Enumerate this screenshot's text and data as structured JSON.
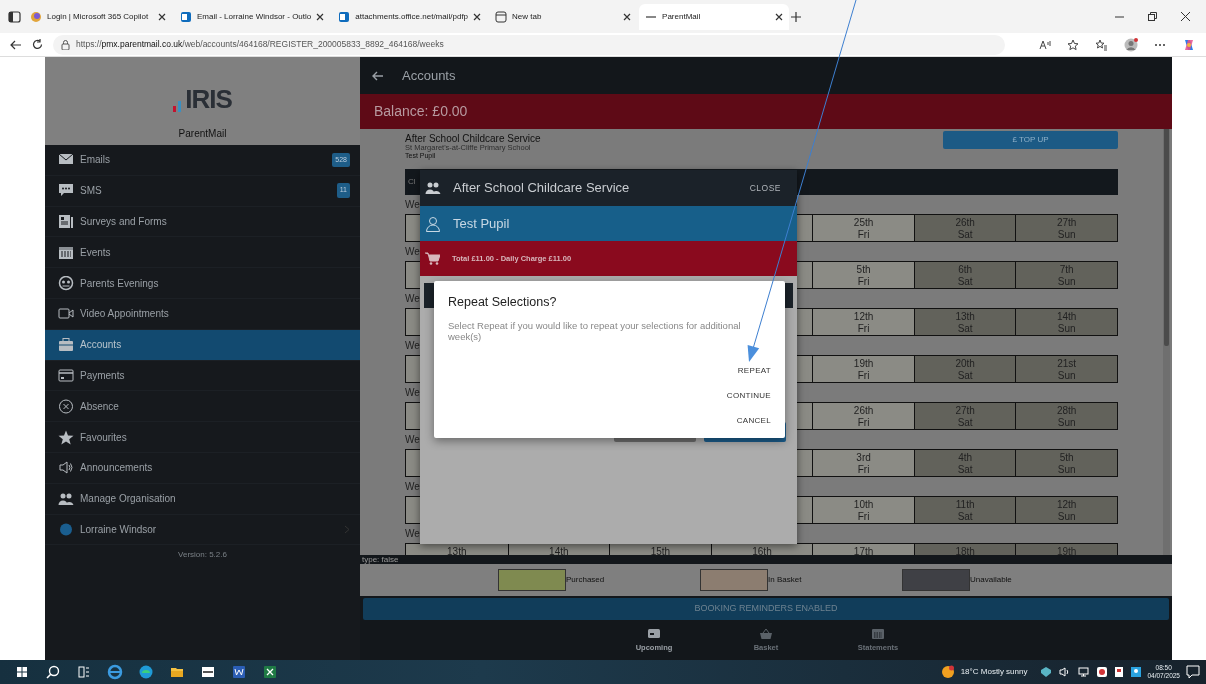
{
  "browser": {
    "tabs": [
      {
        "title": "Login | Microsoft 365 Copilot",
        "selected": false
      },
      {
        "title": "Email - Lorraine Windsor - Outlo",
        "selected": false
      },
      {
        "title": "attachments.office.net/mail/pdfp",
        "selected": false
      },
      {
        "title": "New tab",
        "selected": false
      },
      {
        "title": "ParentMail",
        "selected": true
      }
    ],
    "address": "https://**pmx.parentmail.co.uk**/web/accounts/464168/REGISTER_200005833_8892_464168/weeks"
  },
  "sidebar": {
    "logo": "IRIS",
    "app_name": "ParentMail",
    "items": [
      {
        "label": "Emails",
        "badge": "528",
        "selected": false
      },
      {
        "label": "SMS",
        "badge": "11",
        "selected": false
      },
      {
        "label": "Surveys and Forms",
        "selected": false
      },
      {
        "label": "Events",
        "selected": false
      },
      {
        "label": "Parents Evenings",
        "selected": false
      },
      {
        "label": "Video Appointments",
        "selected": false
      },
      {
        "label": "Accounts",
        "selected": true
      },
      {
        "label": "Payments",
        "selected": false
      },
      {
        "label": "Absence",
        "selected": false
      },
      {
        "label": "Favourites",
        "selected": false
      },
      {
        "label": "Announcements",
        "selected": false
      },
      {
        "label": "Manage Organisation",
        "selected": false
      }
    ],
    "user": "Lorraine Windsor",
    "version": "Version: 5.2.6"
  },
  "header": {
    "title": "Accounts"
  },
  "balance": "Balance: £0.00",
  "service": {
    "title": "After School Childcare Service",
    "school": "St Margaret's-at-Cliffe Primary School",
    "pupil": "Test Pupil",
    "top_up": "£ TOP UP"
  },
  "calendar": {
    "bar_label": "Cl",
    "weeks": [
      {
        "label": "We",
        "days": [
          {
            "date": "25th",
            "day": "Fri",
            "unavailable": false
          },
          {
            "date": "26th",
            "day": "Sat",
            "unavailable": true
          },
          {
            "date": "27th",
            "day": "Sun",
            "unavailable": true
          }
        ]
      },
      {
        "label": "We",
        "days": [
          {
            "date": "5th",
            "day": "Fri",
            "unavailable": false
          },
          {
            "date": "6th",
            "day": "Sat",
            "unavailable": true
          },
          {
            "date": "7th",
            "day": "Sun",
            "unavailable": true
          }
        ]
      },
      {
        "label": "We",
        "days": [
          {
            "date": "12th",
            "day": "Fri",
            "unavailable": false
          },
          {
            "date": "13th",
            "day": "Sat",
            "unavailable": true
          },
          {
            "date": "14th",
            "day": "Sun",
            "unavailable": true
          }
        ]
      },
      {
        "label": "We",
        "days": [
          {
            "date": "19th",
            "day": "Fri",
            "unavailable": false
          },
          {
            "date": "20th",
            "day": "Sat",
            "unavailable": true
          },
          {
            "date": "21st",
            "day": "Sun",
            "unavailable": true
          }
        ]
      },
      {
        "label": "We",
        "days": [
          {
            "date": "26th",
            "day": "Fri",
            "unavailable": false
          },
          {
            "date": "27th",
            "day": "Sat",
            "unavailable": true
          },
          {
            "date": "28th",
            "day": "Sun",
            "unavailable": true
          }
        ]
      },
      {
        "label": "We",
        "days": [
          {
            "date": "3rd",
            "day": "Fri",
            "unavailable": false
          },
          {
            "date": "4th",
            "day": "Sat",
            "unavailable": true
          },
          {
            "date": "5th",
            "day": "Sun",
            "unavailable": true
          }
        ]
      },
      {
        "label": "We",
        "days": [
          {
            "date": "10th",
            "day": "Fri",
            "unavailable": false
          },
          {
            "date": "11th",
            "day": "Sat",
            "unavailable": true
          },
          {
            "date": "12th",
            "day": "Sun",
            "unavailable": true
          }
        ]
      },
      {
        "label": "We",
        "days": [
          {
            "date": "13th",
            "unavailable": false
          },
          {
            "date": "14th",
            "unavailable": false
          },
          {
            "date": "15th",
            "unavailable": false
          },
          {
            "date": "16th",
            "unavailable": false
          },
          {
            "date": "17th",
            "unavailable": false
          },
          {
            "date": "18th",
            "unavailable": true
          },
          {
            "date": "19th",
            "unavailable": true
          }
        ]
      }
    ]
  },
  "debug": "type: false",
  "legend": [
    {
      "label": "Purchased",
      "color": "#7f8a50"
    },
    {
      "label": "In Basket",
      "color": "#8c7d70"
    },
    {
      "label": "Unavailable",
      "color": "#3f4045"
    }
  ],
  "reminder": "BOOKING REMINDERS ENABLED",
  "bottom_nav": [
    {
      "label": "Upcoming",
      "selected": true
    },
    {
      "label": "Basket",
      "selected": false
    },
    {
      "label": "Statements",
      "selected": false
    }
  ],
  "modal": {
    "title": "After School Childcare Service",
    "close": "CLOSE",
    "pupil": "Test Pupil",
    "total": "Total £11.00 - Daily Charge £11.00"
  },
  "dialog": {
    "title": "Repeat Selections?",
    "message": "Select Repeat if you would like to repeat your selections for additional week(s)",
    "actions": [
      "REPEAT",
      "CONTINUE",
      "CANCEL"
    ]
  },
  "taskbar": {
    "weather": "18°C Mostly sunny",
    "time": "08:50",
    "date": "04/07/2025"
  }
}
